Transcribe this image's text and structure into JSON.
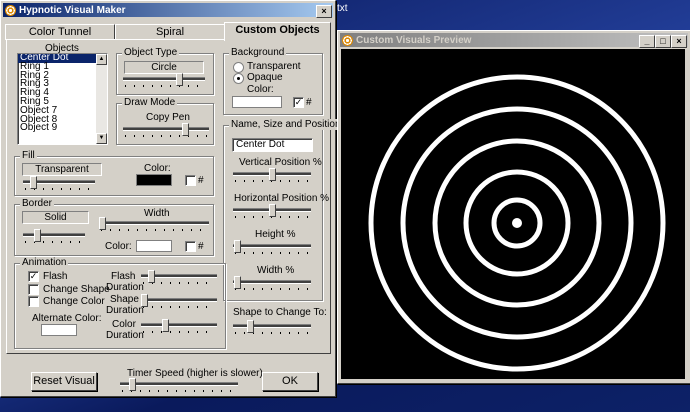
{
  "desktop": {
    "fragment": "txt"
  },
  "main_window": {
    "title": "Hypnotic Visual Maker",
    "tabs": [
      {
        "label": "Color Tunnel",
        "selected": false
      },
      {
        "label": "Spiral",
        "selected": false
      },
      {
        "label": "Custom Objects",
        "selected": true
      }
    ],
    "objects": {
      "label": "Objects",
      "items": [
        "Center Dot",
        "Ring 1",
        "Ring 2",
        "Ring 3",
        "Ring 4",
        "Ring 5",
        "Object 7",
        "Object 8",
        "Object 9"
      ],
      "selected": "Center Dot"
    },
    "object_type": {
      "label": "Object Type",
      "value": "Circle",
      "slider": 0.7
    },
    "draw_mode": {
      "label": "Draw Mode",
      "value": "Copy Pen",
      "slider": 0.75
    },
    "background": {
      "label": "Background",
      "transparent_label": "Transparent",
      "opaque_label": "Opaque",
      "mode": "Opaque",
      "color_label": "Color:",
      "color": "#ffffff",
      "hash": "#",
      "hash_checked": true
    },
    "name_size_position": {
      "label": "Name, Size and Position",
      "name": "Center Dot",
      "vertical_label": "Vertical Position %",
      "vertical": 0.5,
      "horizontal_label": "Horizontal Position %",
      "horizontal": 0.5,
      "height_label": "Height %",
      "height": 0.02,
      "width_label": "Width %",
      "width": 0.02
    },
    "fill": {
      "label": "Fill",
      "value": "Transparent",
      "slider": 0.1,
      "color_label": "Color:",
      "color": "#000000",
      "hash": "#",
      "hash_checked": false
    },
    "border": {
      "label": "Border",
      "value": "Solid",
      "slider": 0.2,
      "width_label": "Width",
      "width": 0.0,
      "color_label": "Color:",
      "color": "#ffffff",
      "hash": "#",
      "hash_checked": false
    },
    "animation": {
      "label": "Animation",
      "flash_label": "Flash",
      "flash": true,
      "change_shape_label": "Change Shape",
      "change_shape": false,
      "change_color_label": "Change Color",
      "change_color": false,
      "alternate_color_label": "Alternate Color:",
      "alternate_color": "#ffffff",
      "flash_duration_label_1": "Flash",
      "flash_duration_label_2": "Duration",
      "flash_duration": 0.1,
      "shape_duration_label_1": "Shape",
      "shape_duration_label_2": "Duration",
      "shape_duration": 0.0,
      "color_duration_label_1": "Color",
      "color_duration_label_2": "Duration",
      "color_duration": 0.3
    },
    "shape_to_change_to": {
      "label": "Shape to Change To:",
      "slider": 0.2
    },
    "timer": {
      "label": "Timer Speed (higher is slower)",
      "slider": 0.08
    },
    "reset_button": "Reset Visual",
    "ok_button": "OK"
  },
  "preview_window": {
    "title": "Custom Visuals Preview",
    "background": "#000000",
    "ring_color": "#ffffff"
  },
  "colors": {
    "title_active": "#0a246a",
    "title_inactive": "#808080",
    "face": "#d4d0c8"
  }
}
